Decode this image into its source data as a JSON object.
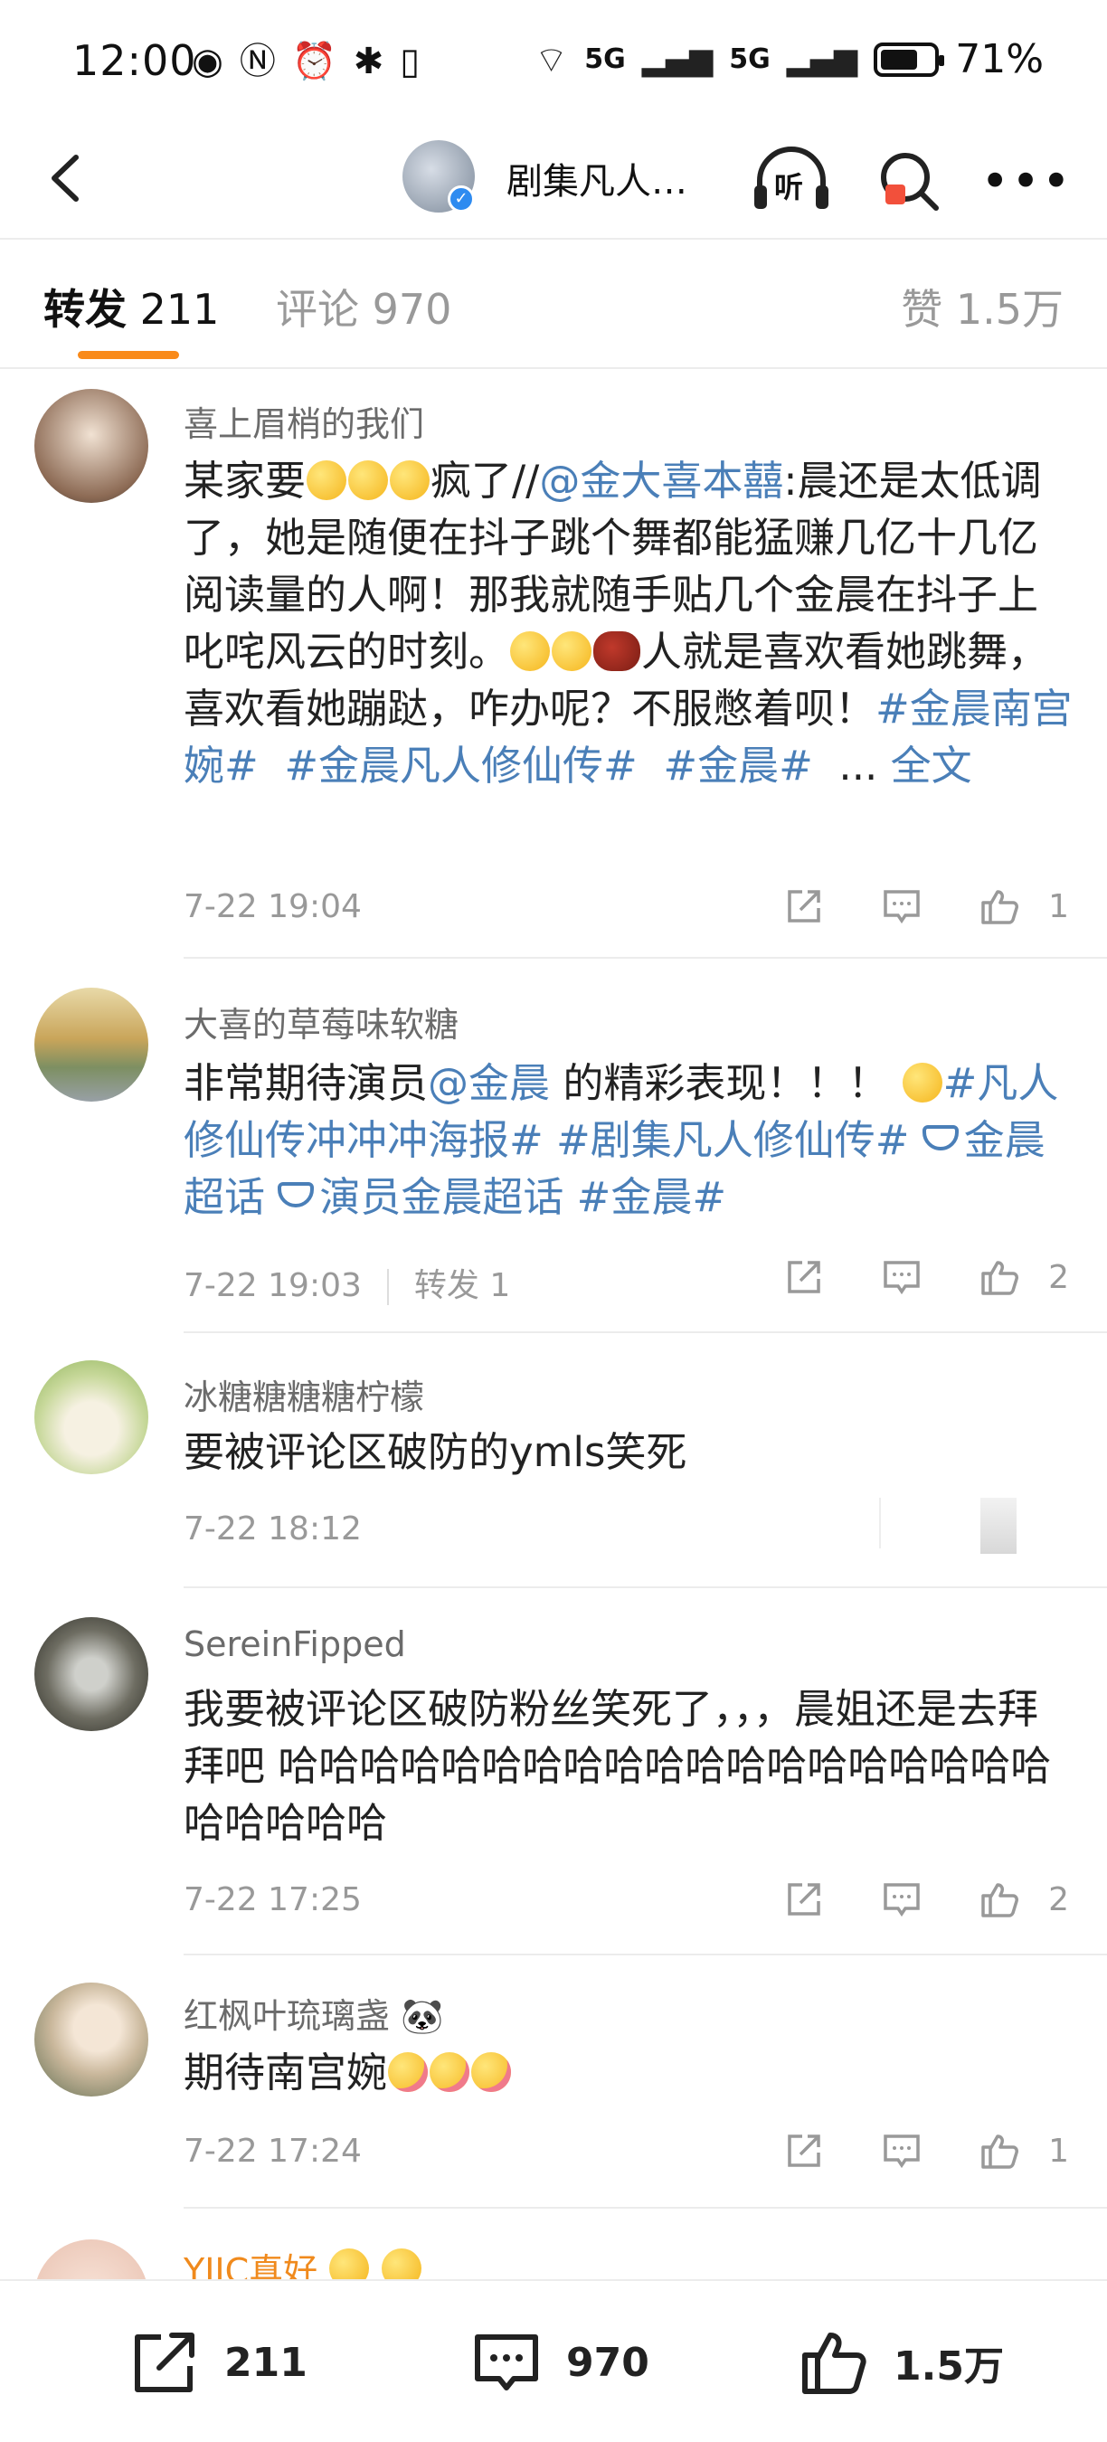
{
  "status_bar": {
    "time": "12:00",
    "left_icons": [
      "eye-icon",
      "nfc-icon",
      "alarm-icon",
      "bluetooth-icon",
      "vibrate-icon"
    ],
    "network_1": "5G",
    "network_2": "5G",
    "battery_percent": "71%",
    "battery_level": 0.71
  },
  "header": {
    "title": "剧集凡人…",
    "listen_label": "听"
  },
  "tabs": {
    "repost_label": "转发",
    "repost_count": "211",
    "comment_label": "评论",
    "comment_count": "970",
    "like_label": "赞",
    "like_count": "1.5万"
  },
  "posts": [
    {
      "username": "喜上眉梢的我们",
      "text_parts": {
        "p1": "某家要",
        "p2": "疯了//",
        "mention": "@金大喜本囍",
        "p3": ":晨还是太低调了，她是随便在抖子跳个舞都能猛赚几亿十几亿阅读量的人啊！那我就随手贴几个金晨在抖子上叱咤风云的时刻。",
        "p4": "人就是喜欢看她跳舞，喜欢看她蹦跶，咋办呢？不服憋着呗！",
        "tag1": "#金晨南宫婉#",
        "tag2": "#金晨凡人修仙传#",
        "tag3": "#金晨#",
        "ellipsis": "...",
        "full_text": "全文"
      },
      "time": "7-22 19:04",
      "like_count": "1"
    },
    {
      "username": "大喜的草莓味软糖",
      "text_parts": {
        "p1": "非常期待演员",
        "mention": "@金晨",
        "p2": " 的精彩表现！！！",
        "tag1": "#凡人修仙传冲冲冲海报#",
        "tag2": "#剧集凡人修仙传#",
        "tag3": "金晨超话",
        "tag4": "演员金晨超话",
        "tag5": "#金晨#"
      },
      "time": "7-22 19:03",
      "repost_label": "转发 1",
      "like_count": "2"
    },
    {
      "username": "冰糖糖糖糖柠檬",
      "text": "要被评论区破防的ymls笑死",
      "time": "7-22 18:12"
    },
    {
      "username": "SereinFipped",
      "text": "我要被评论区破防粉丝笑死了，，，晨姐还是去拜拜吧 哈哈哈哈哈哈哈哈哈哈哈哈哈哈哈哈哈哈哈哈哈哈哈哈",
      "time": "7-22 17:25",
      "like_count": "2"
    },
    {
      "username": "红枫叶琉璃盏",
      "badge": "🐼",
      "text": "期待南宫婉",
      "time": "7-22 17:24",
      "like_count": "1"
    },
    {
      "username": "YJJC真好"
    }
  ],
  "bottom_bar": {
    "repost_count": "211",
    "comment_count": "970",
    "like_count": "1.5万"
  },
  "colors": {
    "accent": "#f98a1a",
    "link": "#4a7fb8",
    "muted": "#999999"
  }
}
